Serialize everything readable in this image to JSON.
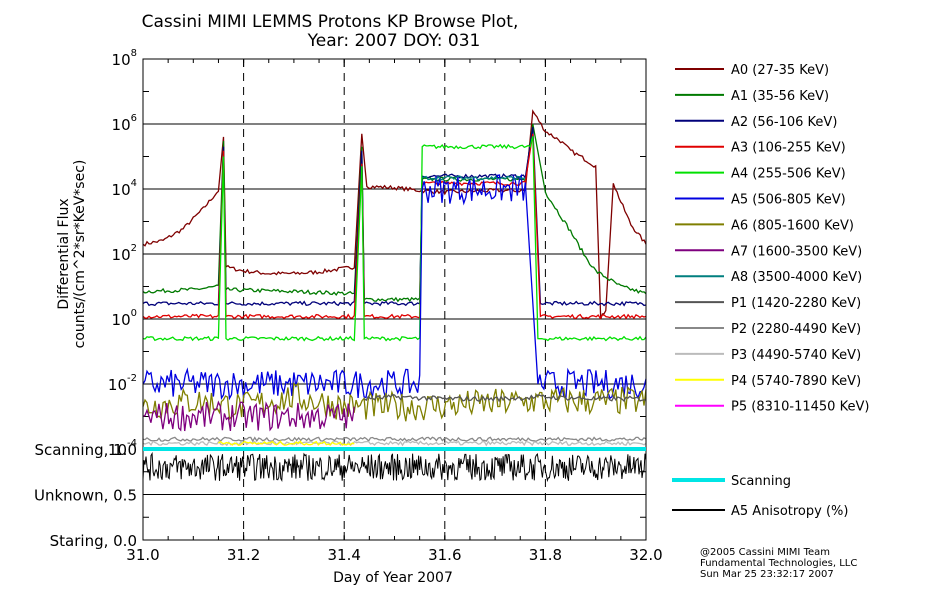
{
  "chart_data": {
    "type": "line",
    "title_line1": "Cassini MIMI LEMMS Protons KP Browse Plot,",
    "title_line2": "Year: 2007 DOY: 031",
    "xlabel": "Day of Year 2007",
    "ylabel_line1": "Differential Flux",
    "ylabel_line2": "counts/(cm^2*sr*KeV*sec)",
    "xlim": [
      31.0,
      32.0
    ],
    "x_ticks": [
      {
        "value": 31.0,
        "label": "31.0"
      },
      {
        "value": 31.2,
        "label": "31.2"
      },
      {
        "value": 31.4,
        "label": "31.4"
      },
      {
        "value": 31.6,
        "label": "31.6"
      },
      {
        "value": 31.8,
        "label": "31.8"
      },
      {
        "value": 32.0,
        "label": "32.0"
      }
    ],
    "y_scale": "log",
    "ylim": [
      0.0001,
      100000000
    ],
    "y_ticks": [
      {
        "exp": -4,
        "base": "10",
        "sup": "-4"
      },
      {
        "exp": -2,
        "base": "10",
        "sup": "-2"
      },
      {
        "exp": 0,
        "base": "10",
        "sup": "0"
      },
      {
        "exp": 2,
        "base": "10",
        "sup": "2"
      },
      {
        "exp": 4,
        "base": "10",
        "sup": "4"
      },
      {
        "exp": 6,
        "base": "10",
        "sup": "6"
      },
      {
        "exp": 8,
        "base": "10",
        "sup": "8"
      }
    ],
    "vertical_dashed_lines": [
      31.2,
      31.4,
      31.6,
      31.8
    ],
    "series": [
      {
        "name": "A0 (27-35 KeV)",
        "color": "#7f0000",
        "points": [
          [
            31.0,
            200
          ],
          [
            31.04,
            260
          ],
          [
            31.08,
            600
          ],
          [
            31.12,
            2500
          ],
          [
            31.15,
            9000
          ],
          [
            31.16,
            400000
          ],
          [
            31.165,
            40
          ],
          [
            31.2,
            30
          ],
          [
            31.25,
            25
          ],
          [
            31.3,
            25
          ],
          [
            31.35,
            28
          ],
          [
            31.42,
            40
          ],
          [
            31.435,
            500000
          ],
          [
            31.445,
            12000
          ],
          [
            31.5,
            11000
          ],
          [
            31.55,
            9000
          ],
          [
            31.6,
            8000
          ],
          [
            31.65,
            8500
          ],
          [
            31.7,
            9000
          ],
          [
            31.76,
            9000
          ],
          [
            31.775,
            2500000
          ],
          [
            31.8,
            600000
          ],
          [
            31.83,
            300000
          ],
          [
            31.85,
            150000
          ],
          [
            31.87,
            100000
          ],
          [
            31.9,
            50000
          ],
          [
            31.91,
            1
          ],
          [
            31.92,
            2
          ],
          [
            31.935,
            15000
          ],
          [
            31.95,
            4000
          ],
          [
            31.97,
            800
          ],
          [
            32.0,
            200
          ]
        ]
      },
      {
        "name": "A1 (35-56 KeV)",
        "color": "#007a00",
        "points": [
          [
            31.0,
            7
          ],
          [
            31.1,
            8
          ],
          [
            31.15,
            10
          ],
          [
            31.16,
            300000
          ],
          [
            31.165,
            8
          ],
          [
            31.3,
            7
          ],
          [
            31.42,
            6
          ],
          [
            31.435,
            200000
          ],
          [
            31.44,
            4
          ],
          [
            31.55,
            4
          ],
          [
            31.555,
            20000
          ],
          [
            31.7,
            20000
          ],
          [
            31.76,
            20000
          ],
          [
            31.775,
            1000000
          ],
          [
            31.8,
            8000
          ],
          [
            31.85,
            500
          ],
          [
            31.88,
            80
          ],
          [
            31.9,
            30
          ],
          [
            31.95,
            10
          ],
          [
            32.0,
            6
          ]
        ]
      },
      {
        "name": "A2 (56-106 KeV)",
        "color": "#00007a",
        "points": [
          [
            31.0,
            3
          ],
          [
            31.15,
            3
          ],
          [
            31.16,
            200000
          ],
          [
            31.165,
            3
          ],
          [
            31.42,
            3
          ],
          [
            31.435,
            150000
          ],
          [
            31.44,
            3
          ],
          [
            31.55,
            3
          ],
          [
            31.555,
            25000
          ],
          [
            31.76,
            25000
          ],
          [
            31.775,
            800000
          ],
          [
            31.79,
            3
          ],
          [
            32.0,
            3
          ]
        ]
      },
      {
        "name": "A3 (106-255 KeV)",
        "color": "#e00000",
        "points": [
          [
            31.0,
            1.2
          ],
          [
            31.15,
            1.2
          ],
          [
            31.16,
            150000
          ],
          [
            31.165,
            1.2
          ],
          [
            31.42,
            1.2
          ],
          [
            31.435,
            60000
          ],
          [
            31.44,
            1.2
          ],
          [
            31.55,
            1.2
          ],
          [
            31.555,
            15000
          ],
          [
            31.76,
            15000
          ],
          [
            31.775,
            500000
          ],
          [
            31.79,
            1.2
          ],
          [
            32.0,
            1.2
          ]
        ]
      },
      {
        "name": "A4 (255-506 KeV)",
        "color": "#00e000",
        "points": [
          [
            31.0,
            0.25
          ],
          [
            31.15,
            0.25
          ],
          [
            31.16,
            100000
          ],
          [
            31.165,
            0.25
          ],
          [
            31.42,
            0.25
          ],
          [
            31.435,
            50000
          ],
          [
            31.44,
            0.25
          ],
          [
            31.55,
            0.25
          ],
          [
            31.555,
            200000
          ],
          [
            31.77,
            200000
          ],
          [
            31.775,
            400000
          ],
          [
            31.785,
            0.25
          ],
          [
            32.0,
            0.25
          ]
        ]
      },
      {
        "name": "A5 (506-805 KeV)",
        "color": "#0000e0",
        "points": [
          [
            31.0,
            0.01
          ],
          [
            31.1,
            0.01
          ],
          [
            31.2,
            0.01
          ],
          [
            31.3,
            0.01
          ],
          [
            31.4,
            0.01
          ],
          [
            31.55,
            0.01
          ],
          [
            31.555,
            10000
          ],
          [
            31.76,
            10000
          ],
          [
            31.785,
            0.01
          ],
          [
            32.0,
            0.01
          ]
        ]
      },
      {
        "name": "A6 (805-1600 KeV)",
        "color": "#7f7f00",
        "points": [
          [
            31.0,
            0.002
          ],
          [
            31.1,
            0.003
          ],
          [
            31.2,
            0.002
          ],
          [
            31.3,
            0.004
          ],
          [
            31.4,
            0.002
          ],
          [
            31.55,
            0.002
          ],
          [
            31.785,
            0.003
          ],
          [
            31.9,
            0.003
          ],
          [
            32.0,
            0.003
          ]
        ]
      },
      {
        "name": "A7 (1600-3500 KeV)",
        "color": "#7f007f",
        "points": [
          [
            31.0,
            0.001
          ],
          [
            31.15,
            0.001
          ],
          [
            31.3,
            0.001
          ],
          [
            31.42,
            0.001
          ]
        ]
      },
      {
        "name": "A8 (3500-4000 KeV)",
        "color": "#007f7f",
        "points": [
          [
            31.555,
            22000
          ],
          [
            31.76,
            22000
          ]
        ]
      },
      {
        "name": "P1 (1420-2280 KeV)",
        "color": "#545454",
        "points": [
          [
            31.44,
            0.0035
          ],
          [
            31.5,
            0.004
          ],
          [
            31.6,
            0.0035
          ],
          [
            31.7,
            0.0035
          ],
          [
            31.8,
            0.004
          ],
          [
            31.9,
            0.0035
          ],
          [
            32.0,
            0.0035
          ]
        ]
      },
      {
        "name": "P2 (2280-4490 KeV)",
        "color": "#888888",
        "points": [
          [
            31.0,
            0.0002
          ],
          [
            32.0,
            0.0002
          ]
        ]
      },
      {
        "name": "P3 (4490-5740 KeV)",
        "color": "#bbbbbb",
        "points": [
          [
            31.0,
            0.00015
          ],
          [
            32.0,
            0.00015
          ]
        ]
      },
      {
        "name": "P4 (5740-7890 KeV)",
        "color": "#ffff00",
        "points": [
          [
            31.15,
            0.00015
          ],
          [
            31.42,
            0.00015
          ]
        ]
      },
      {
        "name": "P5 (8310-11450 KeV)",
        "color": "#ff00ff",
        "points": []
      }
    ],
    "lower_panel": {
      "y_categories": [
        {
          "value": 1.0,
          "label": "Scanning, 1.0"
        },
        {
          "value": 0.5,
          "label": "Unknown, 0.5"
        },
        {
          "value": 0.0,
          "label": "Staring, 0.0"
        }
      ],
      "series": [
        {
          "name": "Scanning",
          "color": "#00e5e5",
          "constant": 1.0
        },
        {
          "name": "A5 Anisotropy (%)",
          "color": "#000000",
          "mean": 0.8,
          "spread": 0.15
        }
      ]
    }
  },
  "credits": {
    "line1": "@2005 Cassini MIMI Team",
    "line2": "Fundamental Technologies, LLC",
    "line3": "Sun Mar 25 23:32:17 2007"
  }
}
